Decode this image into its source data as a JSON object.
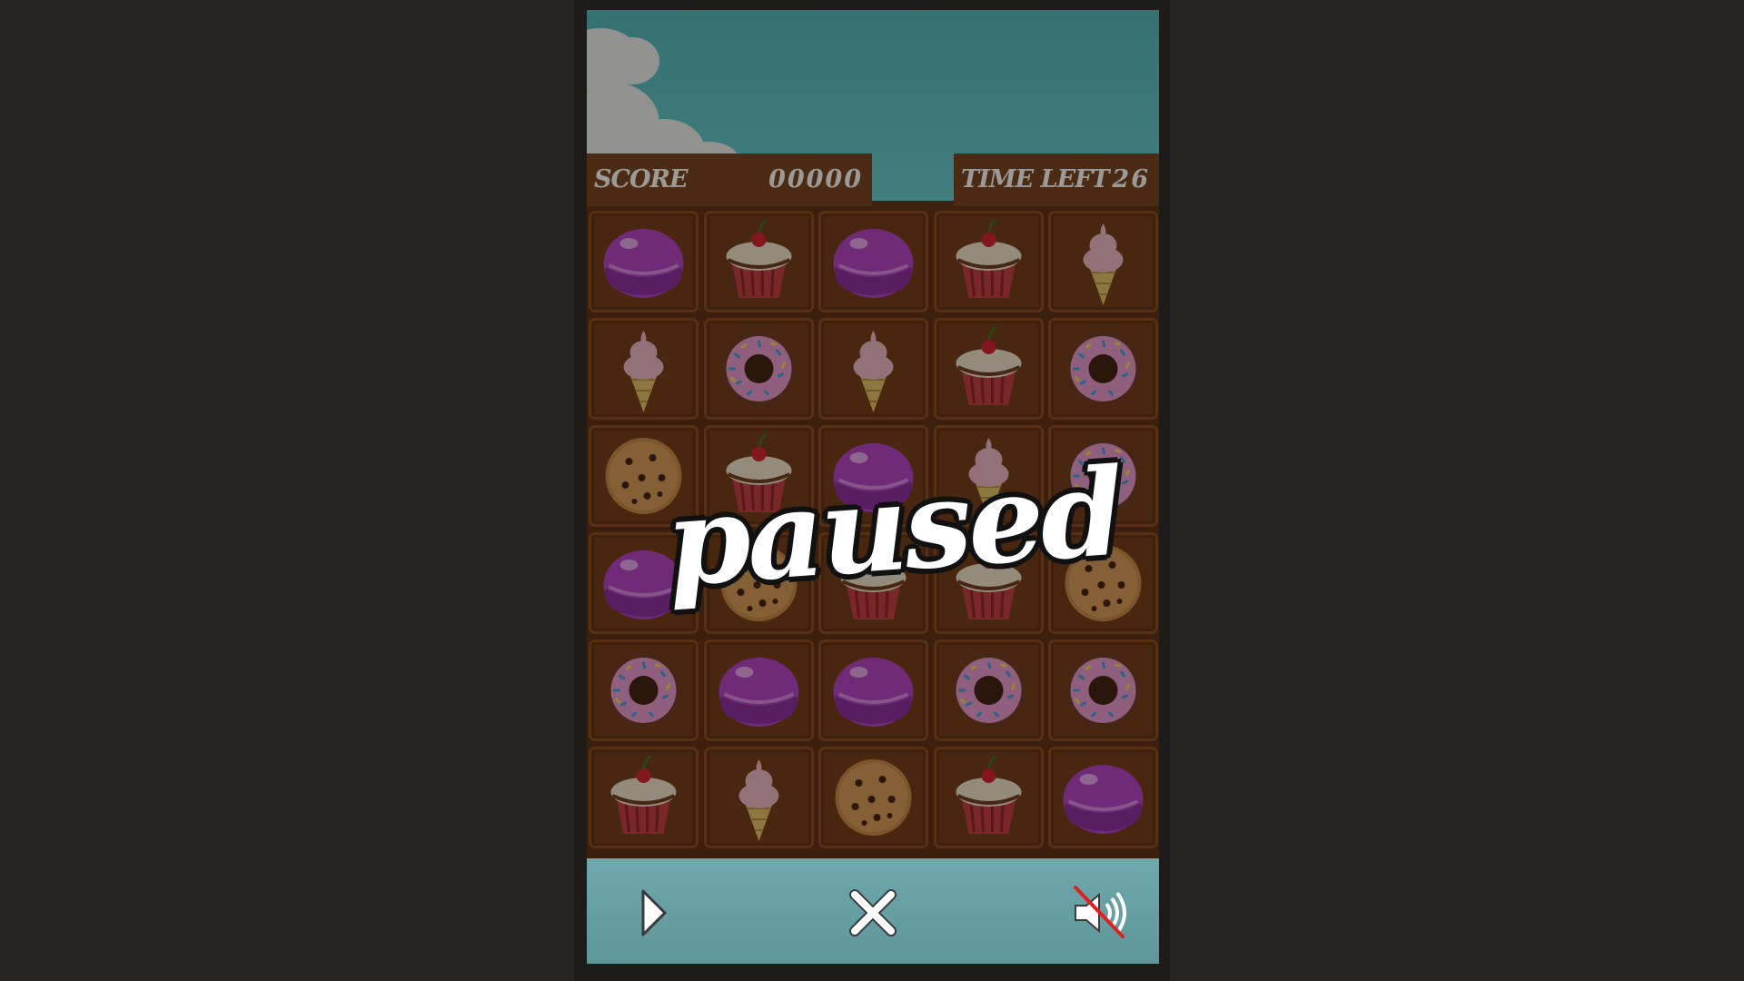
{
  "hud": {
    "score_label": "SCORE",
    "score_value": "00000",
    "time_label": "TIME LEFT",
    "time_value": "26"
  },
  "overlay": {
    "paused_text": "paused"
  },
  "board": {
    "columns": 5,
    "rows": [
      [
        "macaron",
        "cupcake",
        "macaron",
        "cupcake",
        "ice-cream"
      ],
      [
        "ice-cream",
        "donut",
        "ice-cream",
        "cupcake",
        "donut"
      ],
      [
        "cookie",
        "cupcake",
        "macaron",
        "ice-cream",
        "donut"
      ],
      [
        "macaron",
        "cookie",
        "cupcake",
        "cupcake",
        "cookie"
      ],
      [
        "donut",
        "macaron",
        "macaron",
        "donut",
        "donut"
      ],
      [
        "cupcake",
        "ice-cream",
        "cookie",
        "cupcake",
        "macaron"
      ]
    ]
  },
  "controls": {
    "play_icon": "play-icon",
    "close_icon": "close-icon",
    "sound_icon": "sound-muted-icon"
  },
  "colors": {
    "sky": "#66cfd3",
    "panel_brown": "#74401c",
    "board_brown": "#5b2e10",
    "bottom_bar": "#6fa9ad",
    "macaron": "#b43fc8",
    "cupcake_liner": "#c43a40",
    "donut_icing": "#e89ad0",
    "ice_cream": "#f0b8c8",
    "cookie": "#c78a48"
  }
}
